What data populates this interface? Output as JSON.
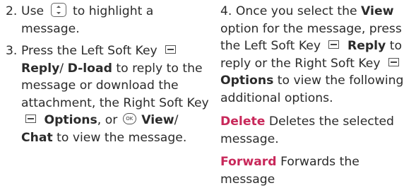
{
  "left_column": {
    "step2": {
      "num": "2.",
      "pre": "Use",
      "post": "to highlight a message."
    },
    "step3": {
      "num": "3.",
      "t1": "Press the Left Soft Key",
      "b1": "Reply",
      "t2": "/",
      "b2": "D-load",
      "t3": "to reply to the message or download the attachment, the Right Soft Key",
      "b3": "Options",
      "t4": ", or",
      "b4": "View",
      "t5": "/",
      "b5": "Chat",
      "t6": "to view the message."
    }
  },
  "right_column": {
    "step4": {
      "num": "4.",
      "t1": "Once you select the",
      "b1": "View",
      "t2": "option for the message, press the Left Soft Key",
      "b2": "Reply",
      "t3": "to reply or the Right Soft Key",
      "b3": "Options",
      "t4": "to view the following additional options."
    },
    "definitions": [
      {
        "term": "Delete",
        "desc": "Deletes the selected message."
      },
      {
        "term": "Forward",
        "desc": "Forwards the message"
      }
    ]
  },
  "icons": {
    "nav": "navigation-key-icon",
    "soft": "soft-key-icon",
    "ok": "ok-key-icon",
    "ok_label": "OK"
  },
  "colors": {
    "text": "#2b2b2b",
    "term_accent": "#c8285a"
  }
}
